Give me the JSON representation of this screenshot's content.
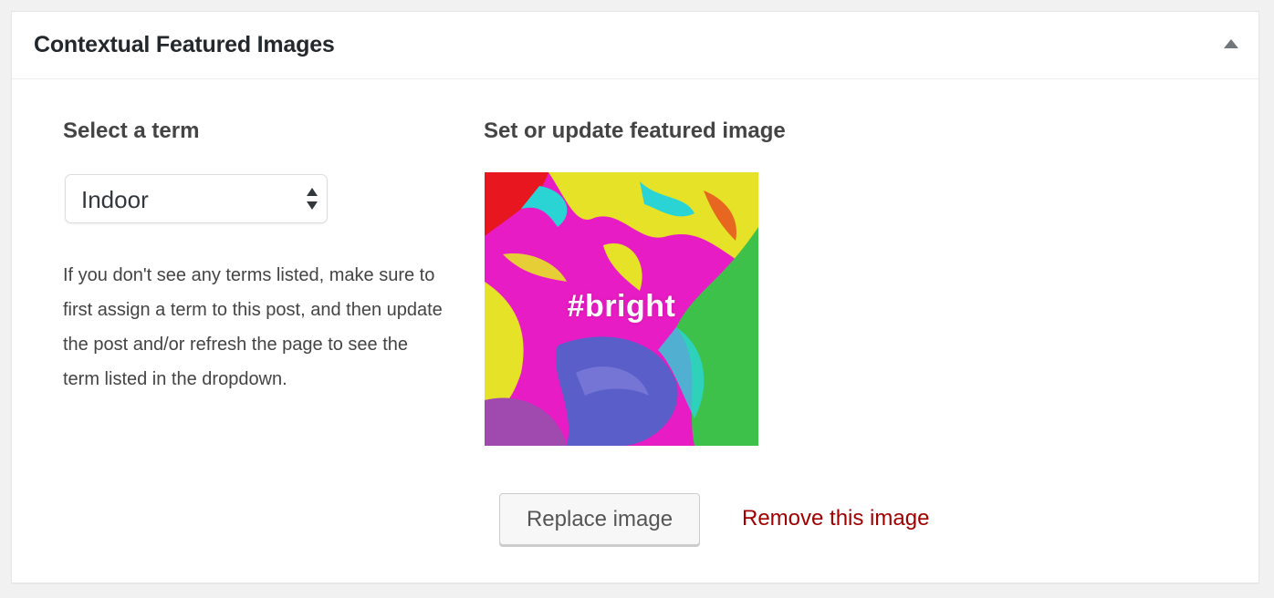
{
  "metabox": {
    "title": "Contextual Featured Images",
    "toggle_icon": "triangle-up-icon"
  },
  "term_section": {
    "heading": "Select a term",
    "selected_term": "Indoor",
    "select_icon": "updown-arrows-icon",
    "help_text": "If you don't see any terms listed, make sure to first assign a term to this post, and then update the post and/or refresh the page to see the term listed in the dropdown."
  },
  "image_section": {
    "heading": "Set or update featured image",
    "image_caption": "#bright",
    "replace_label": "Replace image",
    "remove_label": "Remove this image"
  },
  "colors": {
    "remove_link": "#a00000",
    "heading_text": "#444444",
    "title_text": "#23282d"
  }
}
